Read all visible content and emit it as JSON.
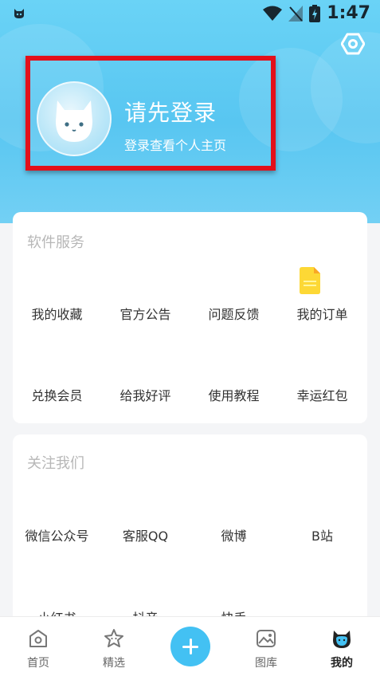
{
  "status_bar": {
    "time": "1:47"
  },
  "profile": {
    "title": "请先登录",
    "subtitle": "登录查看个人主页"
  },
  "services": {
    "title": "软件服务",
    "items": [
      "我的收藏",
      "官方公告",
      "问题反馈",
      "我的订单",
      "兑换会员",
      "给我好评",
      "使用教程",
      "幸运红包"
    ]
  },
  "follow": {
    "title": "关注我们",
    "items": [
      "微信公众号",
      "客服QQ",
      "微博",
      "B站",
      "小红书",
      "抖音",
      "快手"
    ]
  },
  "tabs": [
    {
      "label": "首页",
      "icon": "home-icon"
    },
    {
      "label": "精选",
      "icon": "star-icon"
    },
    {
      "label": "图库",
      "icon": "gallery-icon"
    },
    {
      "label": "我的",
      "icon": "cat-profile-icon"
    }
  ],
  "colors": {
    "accent": "#43c1f3",
    "highlight_border": "#e3101a",
    "header": "#5ec9f3",
    "doc_icon": "#fdd835"
  }
}
